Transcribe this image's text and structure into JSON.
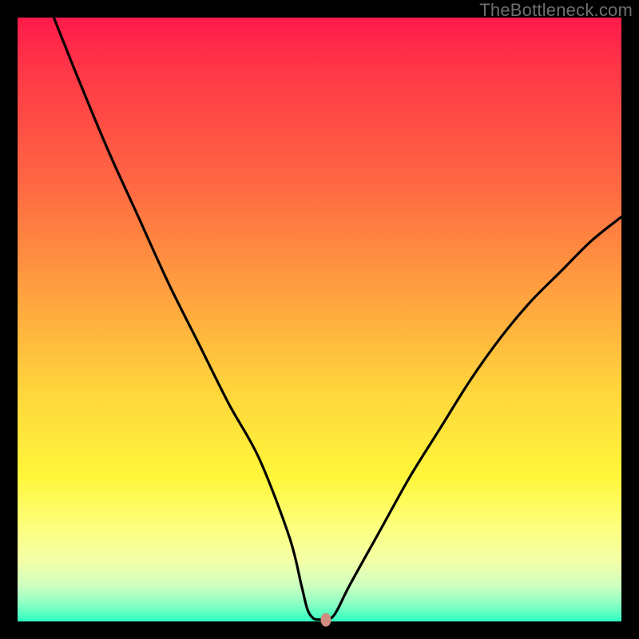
{
  "attribution": "TheBottleneck.com",
  "colors": {
    "frame": "#000000",
    "curve": "#000000",
    "marker": "#cf8d7f",
    "gradient_stops": [
      "#ff1a4b",
      "#ff3547",
      "#ff6943",
      "#ffa23f",
      "#ffd63c",
      "#fff63a",
      "#feff7a",
      "#f3ffa8",
      "#cfffc0",
      "#8effc4",
      "#2dffbf"
    ]
  },
  "chart_data": {
    "type": "line",
    "title": "",
    "xlabel": "",
    "ylabel": "",
    "xlim": [
      0,
      100
    ],
    "ylim": [
      0,
      100
    ],
    "grid": false,
    "legend": false,
    "series": [
      {
        "name": "bottleneck-curve",
        "x": [
          6,
          10,
          15,
          20,
          25,
          30,
          35,
          40,
          45,
          47,
          48,
          49,
          50,
          51,
          52,
          53,
          55,
          60,
          65,
          70,
          75,
          80,
          85,
          90,
          95,
          100
        ],
        "y": [
          100,
          90,
          78,
          67,
          56,
          46,
          36,
          27,
          14,
          6,
          2,
          0.5,
          0.3,
          0.3,
          0.6,
          2,
          6,
          15,
          24,
          32,
          40,
          47,
          53,
          58,
          63,
          67
        ]
      }
    ],
    "marker": {
      "x": 51,
      "y": 0.3
    },
    "annotations": []
  }
}
